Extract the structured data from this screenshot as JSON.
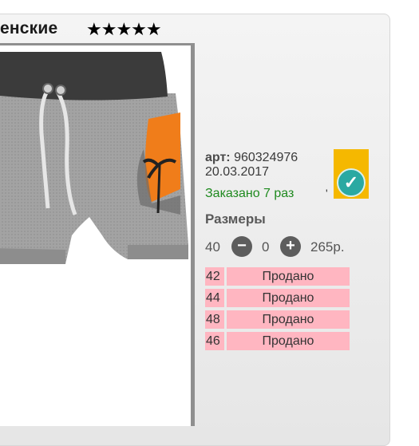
{
  "header": {
    "title": "енские",
    "rating": "★★★★★"
  },
  "product": {
    "art_label": "арт:",
    "art_number": "960324976",
    "date": "20.03.2017",
    "ordered": "Заказано 7 раз",
    "apostrophe": "'",
    "badge_check": "✓"
  },
  "sizes": {
    "label": "Размеры",
    "selected_size": "40",
    "minus": "−",
    "quantity": "0",
    "plus": "+",
    "price": "265р.",
    "rows": [
      {
        "size": "42",
        "status": "Продано"
      },
      {
        "size": "44",
        "status": "Продано"
      },
      {
        "size": "48",
        "status": "Продано"
      },
      {
        "size": "46",
        "status": "Продано"
      }
    ]
  },
  "colors": {
    "sold_bg": "#ffb6c1",
    "ordered_text": "#1f8a1f",
    "badge_bg": "#f5b800",
    "check_bg": "#2aa9a2"
  }
}
